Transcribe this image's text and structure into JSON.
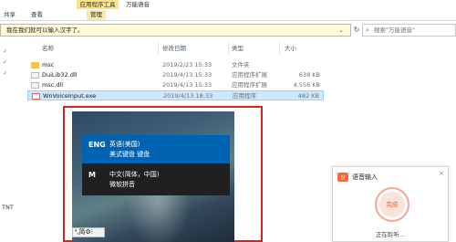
{
  "ribbon": {
    "tabs": [
      "共享",
      "查看",
      "管理"
    ],
    "context_header": "应用程序工具",
    "window_title": "万能语音"
  },
  "address": {
    "path": "我在我们就可以输入汉字了。",
    "refresh_icon": "refresh-icon"
  },
  "search": {
    "placeholder": "搜索\"万能语音\""
  },
  "nav": {
    "glyphs": [
      "✓",
      "✓",
      "✓"
    ],
    "bottom_text": "TNT"
  },
  "columns": {
    "name": "名称",
    "date": "修改日期",
    "type": "类型",
    "size": "大小"
  },
  "files": [
    {
      "name": "msc",
      "date": "2019/2/23 15:33",
      "type": "文件夹",
      "size": "",
      "icon": "folder-icon"
    },
    {
      "name": "DuiLib32.dll",
      "date": "2019/4/13 15:33",
      "type": "应用程序扩展",
      "size": "638 KB",
      "icon": "dll-file-icon"
    },
    {
      "name": "msc.dll",
      "date": "2019/4/13 15:33",
      "type": "应用程序扩展",
      "size": "4,556 KB",
      "icon": "dll-file-icon"
    },
    {
      "name": "WnVoiceInput.exe",
      "date": "2019/4/13 18:33",
      "type": "应用程序",
      "size": "482 KB",
      "icon": "exe-file-icon"
    }
  ],
  "lang_popup": {
    "items": [
      {
        "code": "ENG",
        "name": "英语(美国)",
        "keyboard": "美式键盘 键盘"
      },
      {
        "code": "M",
        "name": "中文(简体，中国)",
        "keyboard": "微软拼音"
      }
    ]
  },
  "ime_bar": {
    "text": "❛,简⚙⁝"
  },
  "voice_widget": {
    "title": "语音输入",
    "button": "完成",
    "status": "正在聆听...",
    "close": "×",
    "logo_glyph": "ッ",
    "accent": "#f26d3d"
  },
  "colors": {
    "highlight_border": "#d42420",
    "selection": "#cce8ff",
    "lang_active": "#0063b1"
  }
}
